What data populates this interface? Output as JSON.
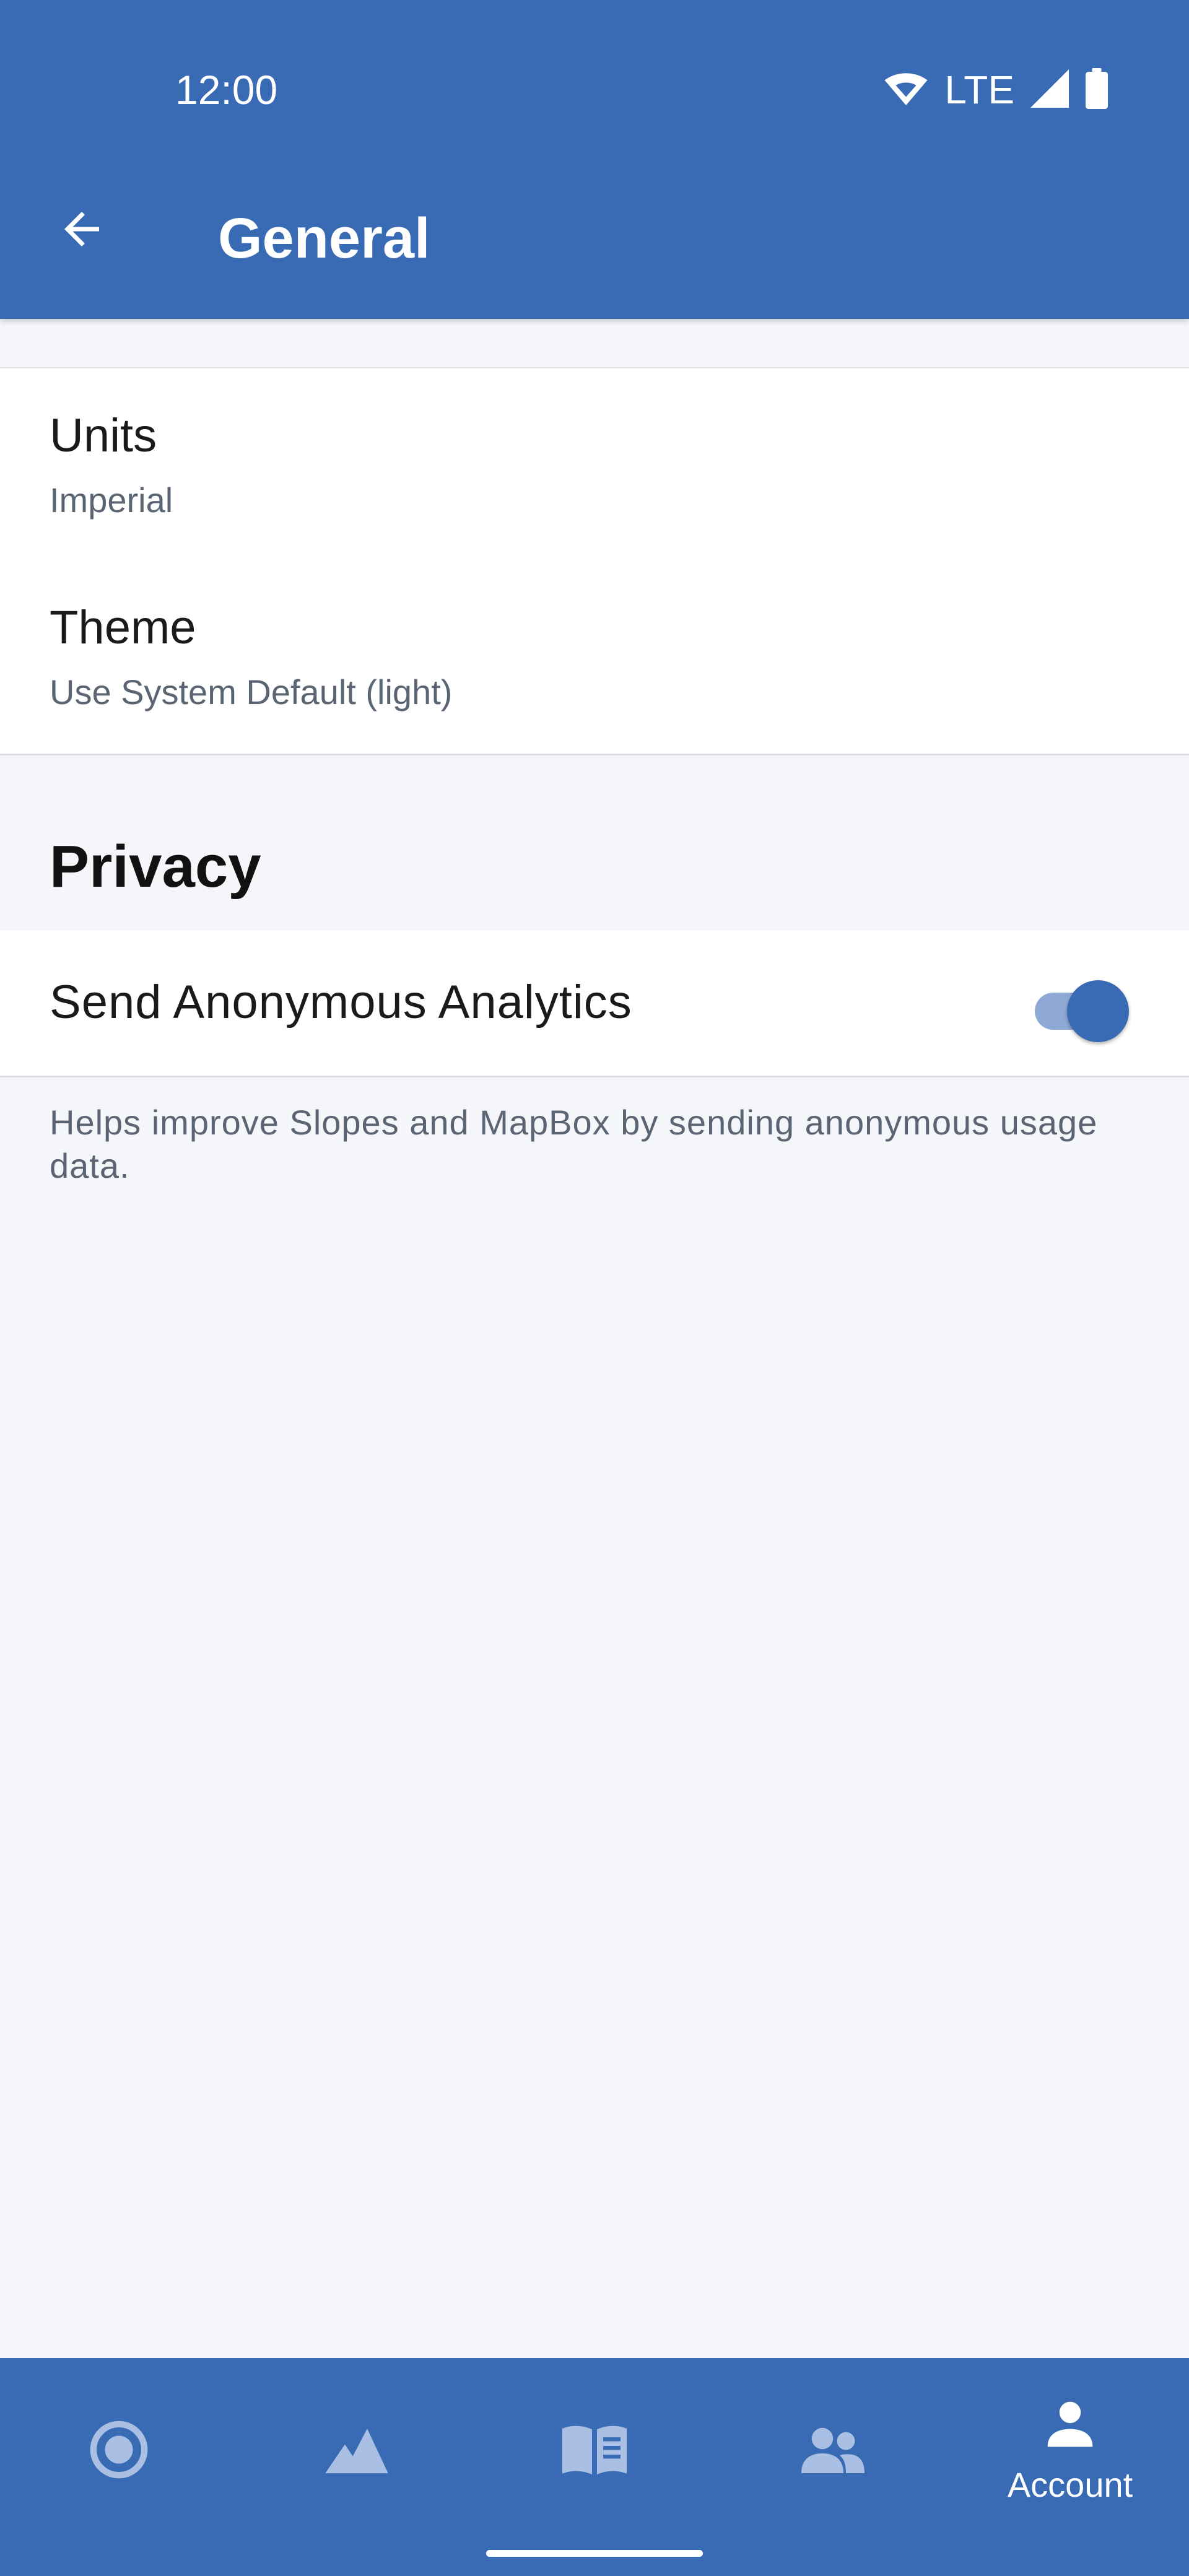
{
  "status_bar": {
    "time": "12:00",
    "network": "LTE",
    "icons": [
      "wifi-icon",
      "cell-signal-icon",
      "battery-icon"
    ]
  },
  "header": {
    "title": "General",
    "back_icon": "arrow-back-icon"
  },
  "general": {
    "units": {
      "title": "Units",
      "value": "Imperial"
    },
    "theme": {
      "title": "Theme",
      "value": "Use System Default (light)"
    }
  },
  "privacy": {
    "header": "Privacy",
    "analytics_label": "Send Anonymous Analytics",
    "analytics_enabled": true,
    "help_text": "Helps improve Slopes and MapBox by sending anonymous usage data."
  },
  "bottom_nav": {
    "items": [
      {
        "icon": "record-icon",
        "label": ""
      },
      {
        "icon": "mountain-icon",
        "label": ""
      },
      {
        "icon": "logbook-icon",
        "label": ""
      },
      {
        "icon": "friends-icon",
        "label": ""
      },
      {
        "icon": "account-icon",
        "label": "Account"
      }
    ],
    "selected_index": 4
  },
  "colors": {
    "primary": "#386bb4",
    "background": "#f4f6fa",
    "inactive_icon": "#a9bfe3",
    "toggle_track": "#8fa9d6"
  }
}
